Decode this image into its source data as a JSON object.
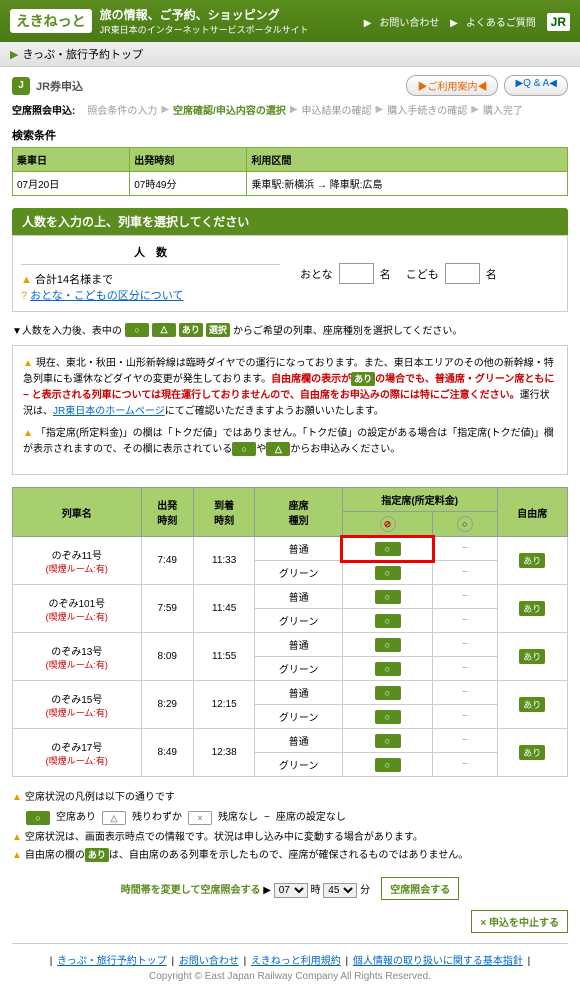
{
  "header": {
    "logo": "えきねっと",
    "tagline": "旅の情報、ご予約、ショッピング",
    "subtag": "JR東日本のインターネットサービスポータルサイト",
    "link1": "お問い合わせ",
    "link2": "よくあるご質問",
    "jr": "JR"
  },
  "subheader": {
    "text": "きっぷ・旅行予約トップ"
  },
  "title": {
    "icon": "J",
    "text": "JR券申込",
    "guide": "ご利用案内",
    "qa": "Q & A"
  },
  "breadcrumb": {
    "label": "空席照会申込:",
    "steps": [
      "照会条件の入力",
      "空席確認/申込内容の選択",
      "申込結果の確認",
      "購入手続きの確認",
      "購入完了"
    ],
    "active": 1
  },
  "cond": {
    "title": "検索条件",
    "h1": "乗車日",
    "h2": "出発時刻",
    "h3": "利用区間",
    "date": "07月20日",
    "time": "07時49分",
    "route": "乗車駅:新横浜 → 降車駅:広島"
  },
  "greenbar": "人数を入力の上、列車を選択してください",
  "pax": {
    "hdr": "人　数",
    "note1": "合計14名様まで",
    "note2": "おとな・こどもの区分について",
    "adult": "おとな",
    "child": "こども",
    "unit": "名"
  },
  "instruct": {
    "pre": "▼人数を入力後、表中の",
    "post": "からご希望の列車、座席種別を選択してください。",
    "o": "○",
    "t": "△",
    "ari": "あり",
    "sel": "選択"
  },
  "notice": {
    "l1a": "現在、東北・秋田・山形新幹線は臨時ダイヤでの運行になっております。また、東日本エリアのその他の新幹線・特急列車にも運休などダイヤの変更が発生しております。",
    "l1b": "自由席欄の表示が",
    "l1c": "の場合でも、普通席・グリーン席ともに",
    "l1d": "と表示される列車については現在運行しておりませんので、自由席をお申込みの際には特にご注意ください。",
    "l1e": "運行状況は、",
    "l1f": "JR東日本のホームページ",
    "l1g": "にてご確認いただきますようお願いいたします。",
    "l2a": "「指定席(所定料金)」の欄は「トクだ値」ではありません。「トクだ値」の設定がある場合は「指定席(トクだ値)」欄が表示されますので、その欄に表示されている",
    "l2b": "や",
    "l2c": "からお申込みください。"
  },
  "thdr": {
    "name": "列車名",
    "dep": "出発\n時刻",
    "arr": "到着\n時刻",
    "seat": "座席\n種別",
    "reserved": "指定席(所定料金)",
    "free": "自由席"
  },
  "trains": [
    {
      "name": "のぞみ11号",
      "room": "(喫煙ルーム:有)",
      "dep": "7:49",
      "arr": "11:33",
      "seats": [
        "普通",
        "グリーン"
      ],
      "avail": [
        [
          "○",
          "−"
        ],
        [
          "○",
          "−"
        ]
      ],
      "free": "あり",
      "hl": true
    },
    {
      "name": "のぞみ101号",
      "room": "(喫煙ルーム:有)",
      "dep": "7:59",
      "arr": "11:45",
      "seats": [
        "普通",
        "グリーン"
      ],
      "avail": [
        [
          "○",
          "−"
        ],
        [
          "○",
          "−"
        ]
      ],
      "free": "あり"
    },
    {
      "name": "のぞみ13号",
      "room": "(喫煙ルーム:有)",
      "dep": "8:09",
      "arr": "11:55",
      "seats": [
        "普通",
        "グリーン"
      ],
      "avail": [
        [
          "○",
          "−"
        ],
        [
          "○",
          "−"
        ]
      ],
      "free": "あり"
    },
    {
      "name": "のぞみ15号",
      "room": "(喫煙ルーム:有)",
      "dep": "8:29",
      "arr": "12:15",
      "seats": [
        "普通",
        "グリーン"
      ],
      "avail": [
        [
          "○",
          "−"
        ],
        [
          "○",
          "−"
        ]
      ],
      "free": "あり"
    },
    {
      "name": "のぞみ17号",
      "room": "(喫煙ルーム:有)",
      "dep": "8:49",
      "arr": "12:38",
      "seats": [
        "普通",
        "グリーン"
      ],
      "avail": [
        [
          "○",
          "−"
        ],
        [
          "○",
          "−"
        ]
      ],
      "free": "あり"
    }
  ],
  "legend": {
    "title": "空席状況の凡例は以下の通りです",
    "r1": {
      "a": "○",
      "at": "空席あり",
      "b": "△",
      "bt": "残りわずか",
      "c": "×",
      "ct": "残席なし",
      "d": "−",
      "dt": "座席の設定なし"
    },
    "r2": "空席状況は、画面表示時点での情報です。状況は申し込み中に変動する場合があります。",
    "r3a": "自由席の欄の",
    "r3b": "は、自由席のある列車を示したもので、座席が確保されるものではありません。"
  },
  "timechange": {
    "label": "時間帯を変更して空席照会する",
    "hour": "07",
    "h": "時",
    "min": "45",
    "m": "分",
    "btn": "空席照会する"
  },
  "cancel": "× 申込を中止する",
  "footer": {
    "l1": "きっぷ・旅行予約トップ",
    "l2": "お問い合わせ",
    "l3": "えきねっと利用規約",
    "l4": "個人情報の取り扱いに関する基本指針",
    "copy": "Copyright © East Japan Railway Company All Rights Reserved."
  }
}
